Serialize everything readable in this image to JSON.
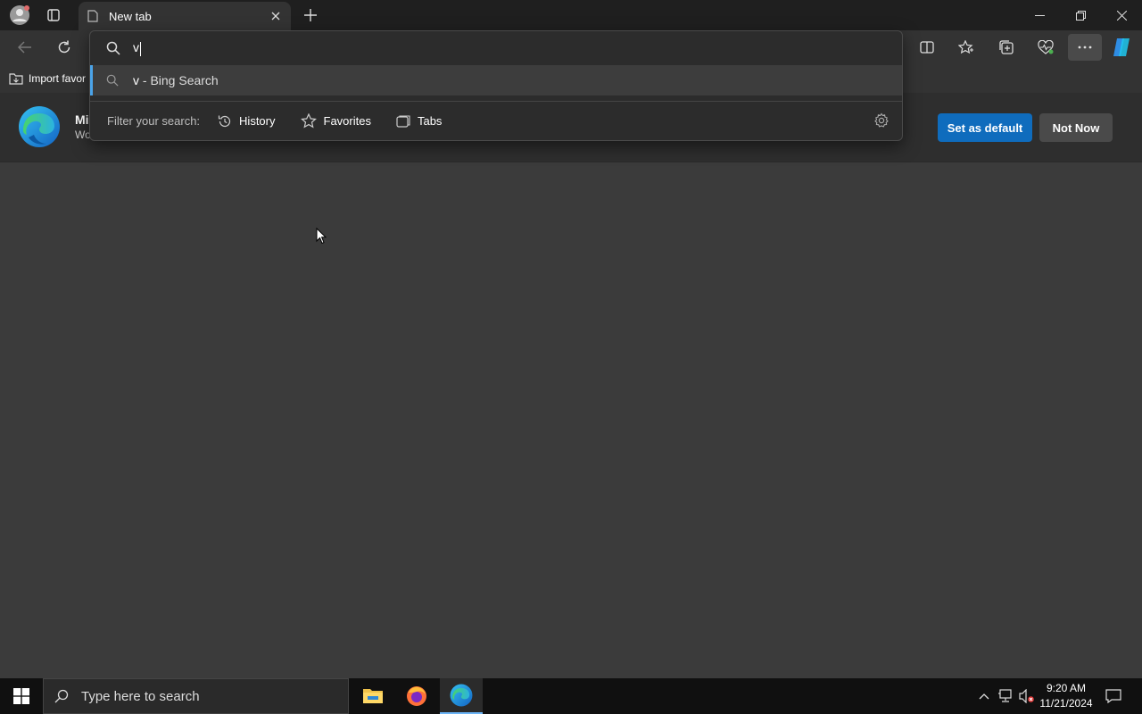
{
  "window": {
    "tab_title": "New tab"
  },
  "favorites_bar": {
    "import_label": "Import favor"
  },
  "banner": {
    "title": "Mi",
    "subtitle": "Wo",
    "set_default_label": "Set as default",
    "not_now_label": "Not Now",
    "accent_color": "#0f6cbd"
  },
  "address_dropdown": {
    "query": "v",
    "suggestion_query": "v",
    "suggestion_suffix": " - Bing Search",
    "filter_label": "Filter your search:",
    "filters": [
      {
        "label": "History",
        "icon": "history-icon"
      },
      {
        "label": "Favorites",
        "icon": "star-icon"
      },
      {
        "label": "Tabs",
        "icon": "tabs-icon"
      }
    ]
  },
  "taskbar": {
    "search_placeholder": "Type here to search",
    "time": "9:20 AM",
    "date": "11/21/2024"
  }
}
